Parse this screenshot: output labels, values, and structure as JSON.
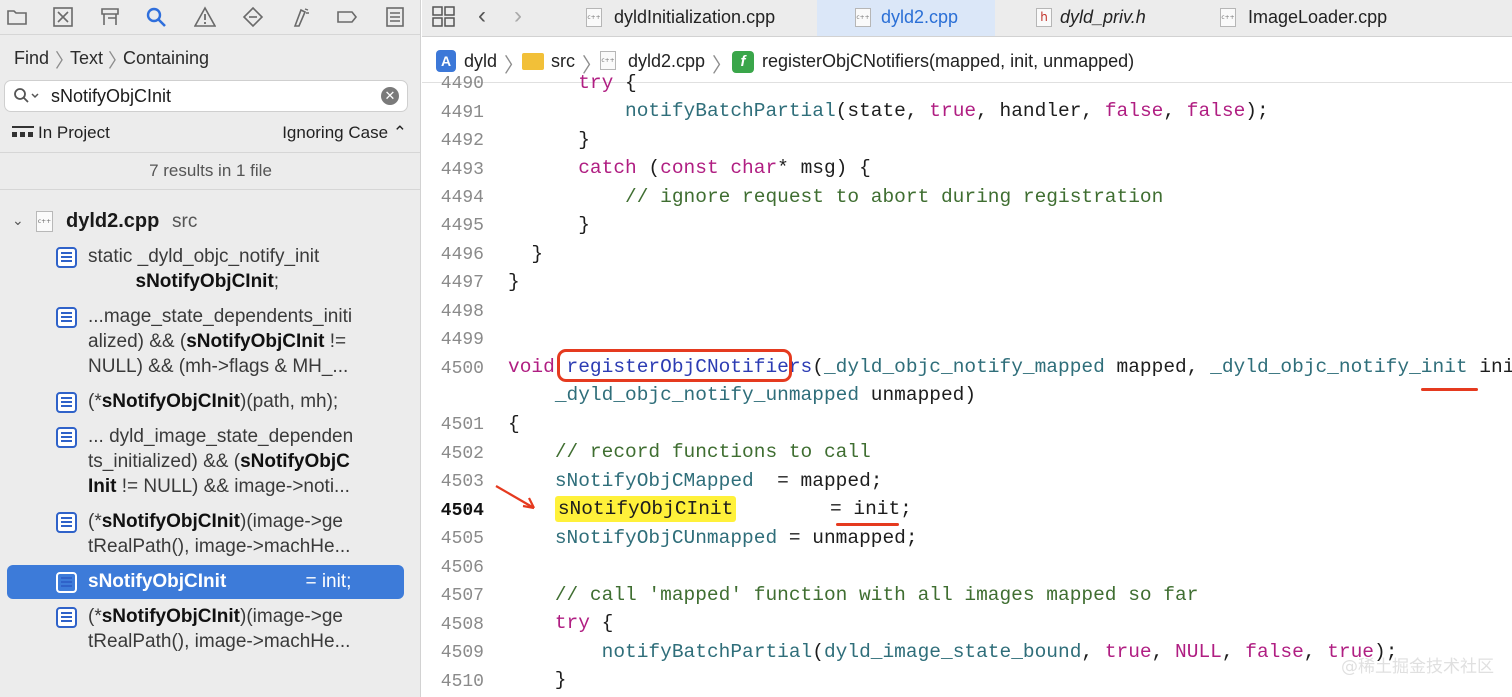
{
  "navigator": {
    "find_breadcrumb": [
      "Find",
      "Text",
      "Containing"
    ],
    "search": {
      "value": "sNotifyObjCInit",
      "placeholder": ""
    },
    "scope": {
      "label": "In Project",
      "case_option": "Ignoring Case ⌃"
    },
    "results_summary": "7 results in 1 file",
    "file": {
      "name": "dyld2.cpp",
      "folder": "src",
      "icon_label": "c++"
    },
    "results": [
      {
        "pre": "static _dyld_objc_notify_init\n         ",
        "match": "sNotifyObjCInit",
        "post": ";"
      },
      {
        "pre": "...mage_state_dependents_initi\nalized) && (",
        "match": "sNotifyObjCInit",
        "post": " !=\nNULL) && (mh->flags & MH_..."
      },
      {
        "pre": "(*",
        "match": "sNotifyObjCInit",
        "post": ")(path, mh);"
      },
      {
        "pre": "... dyld_image_state_dependen\nts_initialized) && (",
        "match": "sNotifyObjC\nInit",
        "post": " != NULL) && image->noti..."
      },
      {
        "pre": "(*",
        "match": "sNotifyObjCInit",
        "post": ")(image->ge\ntRealPath(), image->machHe..."
      },
      {
        "pre": "",
        "match": "sNotifyObjCInit",
        "post": "               = init;"
      },
      {
        "pre": "(*",
        "match": "sNotifyObjCInit",
        "post": ")(image->ge\ntRealPath(), image->machHe..."
      }
    ]
  },
  "editor": {
    "tabs": [
      {
        "label": "dyldInitialization.cpp",
        "icon": "c++"
      },
      {
        "label": "dyld2.cpp",
        "icon": "c++"
      },
      {
        "label": "dyld_priv.h",
        "icon": "h"
      },
      {
        "label": "ImageLoader.cpp",
        "icon": "c++"
      }
    ],
    "jumpbar": {
      "project": "dyld",
      "folder": "src",
      "file": "dyld2.cpp",
      "symbol": "registerObjCNotifiers(mapped, init, unmapped)",
      "symbol_icon": "f"
    },
    "lines": {
      "l4490": "4490",
      "l4491": "4491",
      "l4492": "4492",
      "l4493": "4493",
      "l4494": "4494",
      "l4495": "4495",
      "l4496": "4496",
      "l4497": "4497",
      "l4498": "4498",
      "l4499": "4499",
      "l4500": "4500",
      "l4501": "4501",
      "l4502": "4502",
      "l4503": "4503",
      "l4504": "4504",
      "l4505": "4505",
      "l4506": "4506",
      "l4507": "4507",
      "l4508": "4508",
      "l4509": "4509",
      "l4510": "4510"
    },
    "current_line": "4504"
  },
  "watermark": "@稀土掘金技术社区",
  "colors": {
    "selection": "#3d7bd9",
    "annotation_red": "#e53a1f",
    "highlight_yellow": "#fff13a",
    "keyword": "#b01e82"
  }
}
